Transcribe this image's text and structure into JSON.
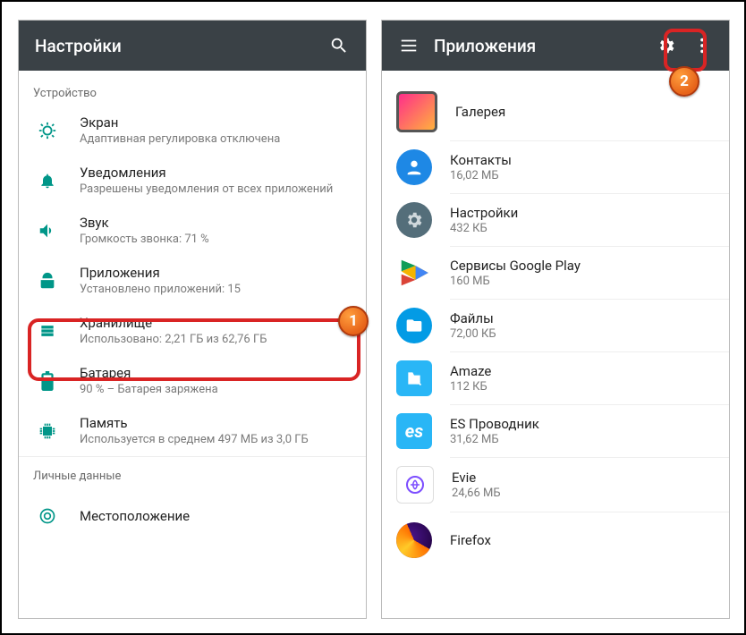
{
  "left": {
    "title": "Настройки",
    "section_device": "Устройство",
    "section_personal": "Личные данные",
    "items": [
      {
        "title": "Экран",
        "sub": "Адаптивная регулировка отключена"
      },
      {
        "title": "Уведомления",
        "sub": "Разрешены уведомления от всех приложений"
      },
      {
        "title": "Звук",
        "sub": "Громкость звонка: 71 %"
      },
      {
        "title": "Приложения",
        "sub": "Установлено приложений: 15"
      },
      {
        "title": "Хранилище",
        "sub": "Использовано: 2,21 ГБ из 62,76 ГБ"
      },
      {
        "title": "Батарея",
        "sub": "90 % – Батарея заряжена"
      },
      {
        "title": "Память",
        "sub": "Используется в среднем 497 МБ из 3,0 ГБ"
      },
      {
        "title": "Местоположение",
        "sub": ""
      }
    ]
  },
  "right": {
    "title": "Приложения",
    "apps": [
      {
        "name": "Галерея",
        "size": ""
      },
      {
        "name": "Контакты",
        "size": "16,02 МБ"
      },
      {
        "name": "Настройки",
        "size": "432 КБ"
      },
      {
        "name": "Сервисы Google Play",
        "size": "160 МБ"
      },
      {
        "name": "Файлы",
        "size": "72,00 КБ"
      },
      {
        "name": "Amaze",
        "size": "112 КБ"
      },
      {
        "name": "ES Проводник",
        "size": "31,62 МБ"
      },
      {
        "name": "Evie",
        "size": "24,66 МБ"
      },
      {
        "name": "Firefox",
        "size": ""
      }
    ]
  },
  "callouts": {
    "one": "1",
    "two": "2"
  }
}
